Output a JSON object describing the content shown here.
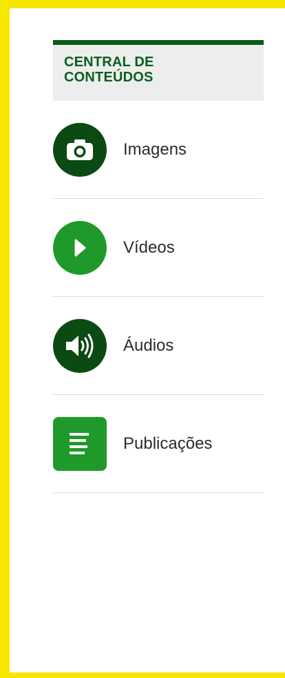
{
  "panel": {
    "title": "CENTRAL DE CONTEÚDOS"
  },
  "colors": {
    "page_border": "#f7e600",
    "header_rule": "#0a5a18",
    "dark_green": "#0b4a12",
    "bright_green": "#1f9a2a"
  },
  "items": [
    {
      "label": "Imagens",
      "icon": "camera-icon"
    },
    {
      "label": "Vídeos",
      "icon": "play-icon"
    },
    {
      "label": "Áudios",
      "icon": "speaker-icon"
    },
    {
      "label": "Publicações",
      "icon": "document-icon"
    }
  ]
}
